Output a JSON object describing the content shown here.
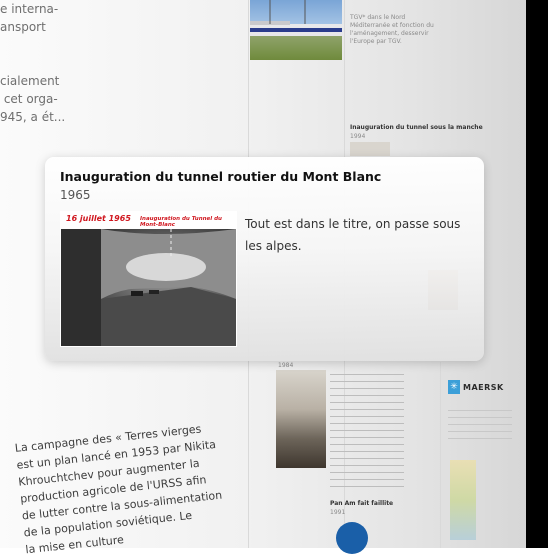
{
  "background": {
    "left_page_text": "e interna-\nansport\n\n\ncialement\n cet orga-\n945, a ét...",
    "tilted_page_text": "La campagne des « Terres vierges\nest un plan lancé en 1953 par Nikita\nKhrouchtchev pour augmenter la\nproduction agricole de l'URSS afin\nde lutter contre la sous-alimentation\nde la population soviétique. Le\nla mise en culture",
    "train_caption": "TGV* dans le Nord\nMéditerranée et fonction du\nl'aménagement, desservir\nl'Europe par TGV.",
    "tunnel_heading": "Inauguration du tunnel sous la manche",
    "tunnel_year": "1994",
    "year_1984": "1984",
    "panam_title": "Pan Am fait faillite",
    "panam_year": "1991",
    "maersk_label": "MAERSK",
    "maersk_star": "✳"
  },
  "popup": {
    "title": "Inauguration du tunnel routier du Mont Blanc",
    "year": "1965",
    "image_date": "16 juillet 1965",
    "image_caption": "Inauguration du Tunnel du Mont-Blanc",
    "description": "Tout est dans le titre, on passe sous les alpes."
  }
}
